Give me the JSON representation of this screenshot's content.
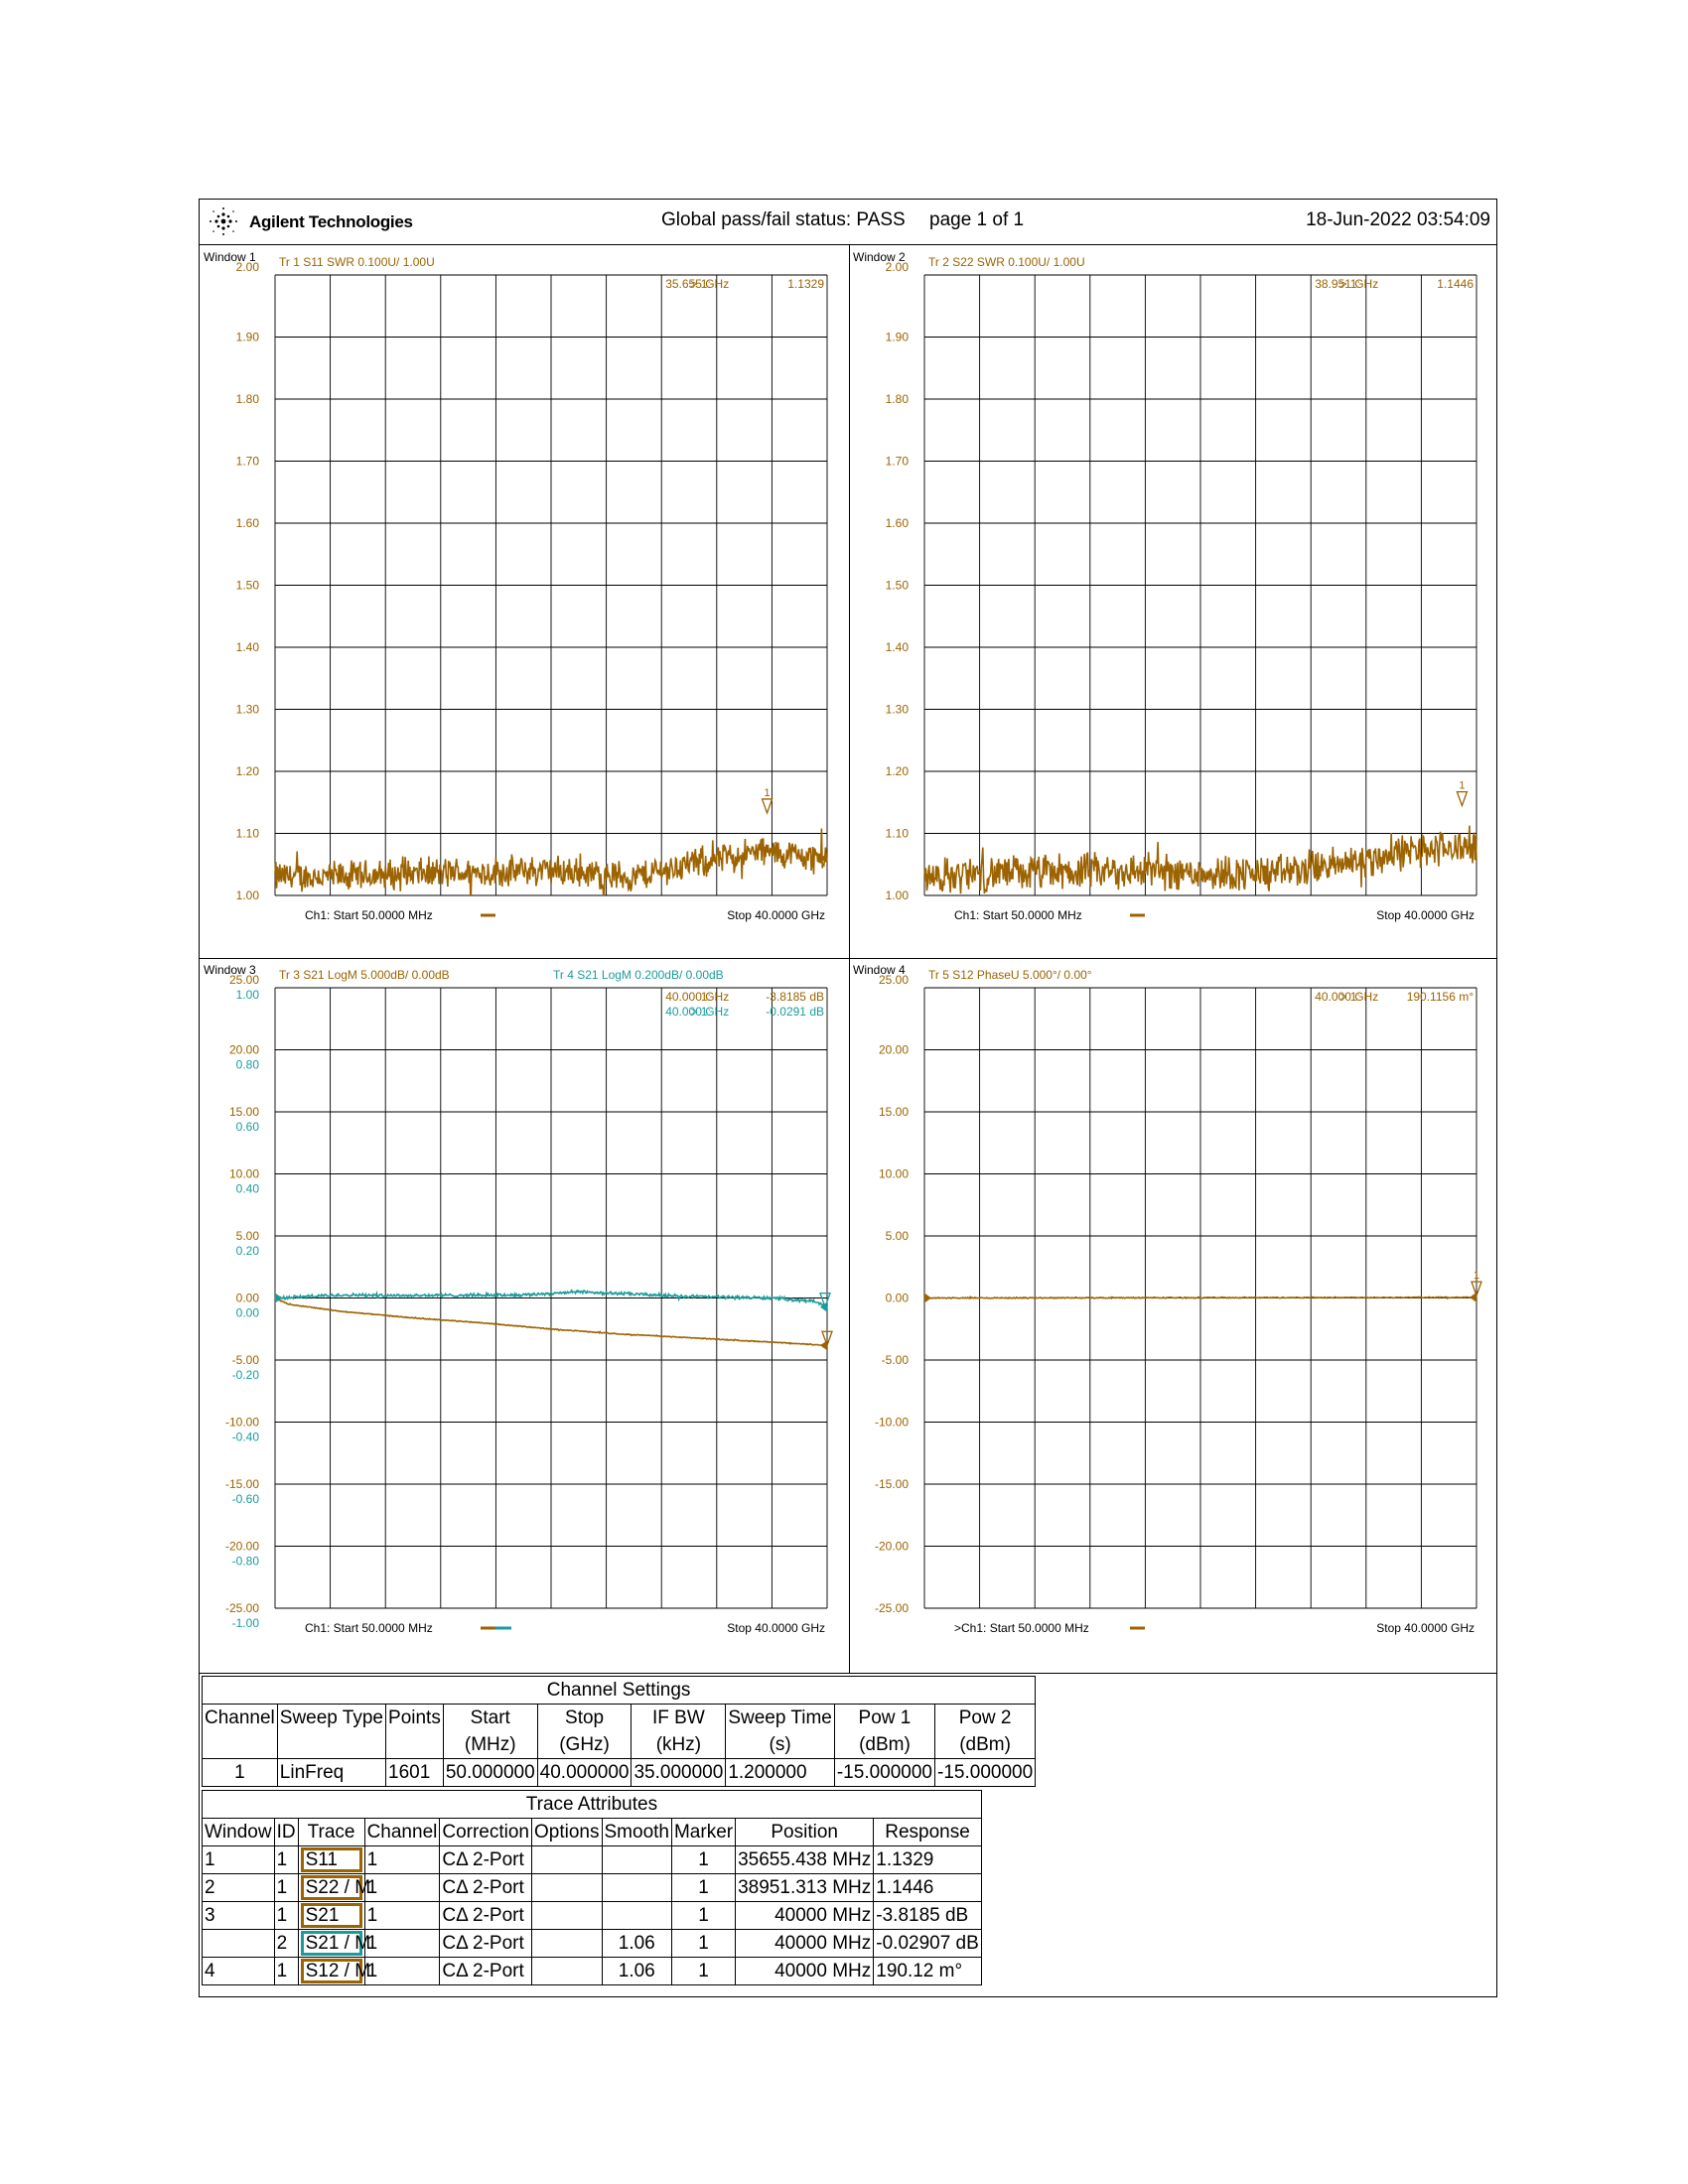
{
  "header": {
    "brand": "Agilent Technologies",
    "status": "Global pass/fail status: PASS",
    "page": "page  1 of  1",
    "datetime": "18-Jun-2022   03:54:09"
  },
  "colors": {
    "trace_brown": "#9c6300",
    "trace_teal": "#1a9c9c"
  },
  "chart_data": [
    {
      "type": "line",
      "window_label": "Window 1",
      "trace_label": "Tr  1   S11 SWR 0.100U/  1.00U",
      "marker": {
        "prefix": "> 1:",
        "x": "35.655 GHz",
        "value": "1.1329",
        "x_ghz": 35.655,
        "y": 1.1329,
        "id": "1"
      },
      "ylim": [
        1.0,
        2.0
      ],
      "yticks": [
        "2.00",
        "1.90",
        "1.80",
        "1.70",
        "1.60",
        "1.50",
        "1.40",
        "1.30",
        "1.20",
        "1.10",
        "1.00"
      ],
      "start_label": "Ch1: Start  50.0000 MHz",
      "stop_label": "Stop  40.0000 GHz",
      "xlim": [
        0.05,
        40.0
      ],
      "series": [
        {
          "color": "#9c6300",
          "mean": [
            [
              0.05,
              1.03
            ],
            [
              5,
              1.03
            ],
            [
              10,
              1.035
            ],
            [
              20,
              1.04
            ],
            [
              26,
              1.03
            ],
            [
              30,
              1.05
            ],
            [
              35,
              1.07
            ],
            [
              40,
              1.06
            ]
          ],
          "noise": 0.03
        }
      ]
    },
    {
      "type": "line",
      "window_label": "Window 2",
      "trace_label": "Tr  2   S22 SWR 0.100U/  1.00U",
      "marker": {
        "prefix": "> 1:",
        "x": "38.951 GHz",
        "value": "1.1446",
        "x_ghz": 38.951,
        "y": 1.1446,
        "id": "1"
      },
      "ylim": [
        1.0,
        2.0
      ],
      "yticks": [
        "2.00",
        "1.90",
        "1.80",
        "1.70",
        "1.60",
        "1.50",
        "1.40",
        "1.30",
        "1.20",
        "1.10",
        "1.00"
      ],
      "start_label": "Ch1: Start  50.0000 MHz",
      "stop_label": "Stop  40.0000 GHz",
      "xlim": [
        0.05,
        40.0
      ],
      "series": [
        {
          "color": "#9c6300",
          "mean": [
            [
              0.05,
              1.03
            ],
            [
              5,
              1.035
            ],
            [
              15,
              1.04
            ],
            [
              25,
              1.035
            ],
            [
              30,
              1.05
            ],
            [
              35,
              1.07
            ],
            [
              40,
              1.08
            ]
          ],
          "noise": 0.035
        }
      ]
    },
    {
      "type": "line",
      "window_label": "Window 3",
      "trace_label": "Tr  3   S21 LogM 5.000dB/  0.00dB",
      "trace_label2": "Tr  4   S21 LogM 0.200dB/  0.00dB",
      "marker": {
        "prefix": "1:",
        "x": "40.000 GHz",
        "value": "-3.8185 dB",
        "x_ghz": 40.0,
        "y": -3.8185,
        "id": ""
      },
      "marker2": {
        "prefix": "> 1:",
        "x": "40.000 GHz",
        "value": "-0.0291 dB",
        "x_ghz": 40.0,
        "y": -0.0291,
        "id": ""
      },
      "ylim": [
        -25,
        25
      ],
      "yticks": [
        "25.00",
        "20.00",
        "15.00",
        "10.00",
        "5.00",
        "0.00",
        "-5.00",
        "-10.00",
        "-15.00",
        "-20.00",
        "-25.00"
      ],
      "yticks2": [
        "1.00",
        "0.80",
        "0.60",
        "0.40",
        "0.20",
        "0.00",
        "-0.20",
        "-0.40",
        "-0.60",
        "-0.80",
        "-1.00"
      ],
      "start_label": "Ch1: Start  50.0000 MHz",
      "stop_label": "Stop  40.0000 GHz",
      "xlim": [
        0.05,
        40.0
      ],
      "series": [
        {
          "color": "#9c6300",
          "mean": [
            [
              0.05,
              0
            ],
            [
              1,
              -0.5
            ],
            [
              5,
              -1.1
            ],
            [
              10,
              -1.6
            ],
            [
              15,
              -2.0
            ],
            [
              20,
              -2.5
            ],
            [
              25,
              -2.9
            ],
            [
              30,
              -3.2
            ],
            [
              35,
              -3.5
            ],
            [
              40,
              -3.82
            ]
          ],
          "noise": 0.04
        },
        {
          "color": "#1a9c9c",
          "scale": 25,
          "mean": [
            [
              0.05,
              0
            ],
            [
              5,
              0.01
            ],
            [
              10,
              0.008
            ],
            [
              18,
              0.01
            ],
            [
              22,
              0.02
            ],
            [
              30,
              0.005
            ],
            [
              36,
              0
            ],
            [
              39,
              -0.01
            ],
            [
              40,
              -0.029
            ]
          ],
          "noise": 0.006
        }
      ]
    },
    {
      "type": "line",
      "window_label": "Window 4",
      "trace_label": "Tr  5   S12 PhaseU 5.000°/  0.00°",
      "marker": {
        "prefix": "> 1:",
        "x": "40.000 GHz",
        "value": "190.1156 m°",
        "x_ghz": 40.0,
        "y": 0.19,
        "id": "1"
      },
      "ylim": [
        -25,
        25
      ],
      "yticks": [
        "25.00",
        "20.00",
        "15.00",
        "10.00",
        "5.00",
        "0.00",
        "-5.00",
        "-10.00",
        "-15.00",
        "-20.00",
        "-25.00"
      ],
      "start_label": ">Ch1: Start  50.0000 MHz",
      "stop_label": "Stop  40.0000 GHz",
      "xlim": [
        0.05,
        40.0
      ],
      "series": [
        {
          "color": "#9c6300",
          "mean": [
            [
              0.05,
              0
            ],
            [
              40,
              0.05
            ]
          ],
          "noise": 0.05
        }
      ]
    }
  ],
  "channel_settings": {
    "title": "Channel Settings",
    "headers": [
      "Channel",
      "Sweep Type",
      "Points",
      "Start",
      "Stop",
      "IF BW",
      "Sweep Time",
      "Pow 1",
      "Pow 2"
    ],
    "units": [
      "",
      "",
      "",
      "(MHz)",
      "(GHz)",
      "(kHz)",
      "(s)",
      "(dBm)",
      "(dBm)"
    ],
    "rows": [
      [
        "1",
        "LinFreq",
        "1601",
        "50.000000",
        "40.000000",
        "35.000000",
        "1.200000",
        "-15.000000",
        "-15.000000"
      ]
    ]
  },
  "trace_attributes": {
    "title": "Trace Attributes",
    "headers": [
      "Window",
      "ID",
      "Trace",
      "Channel",
      "Correction",
      "Options",
      "Smooth",
      "Marker",
      "Position",
      "Response"
    ],
    "rows": [
      [
        "1",
        "1",
        "S11",
        "1",
        "CΔ 2-Port",
        "",
        "",
        "1",
        "35655.438 MHz",
        "1.1329"
      ],
      [
        "2",
        "1",
        "S22 / M",
        "1",
        "CΔ 2-Port",
        "",
        "",
        "1",
        "38951.313 MHz",
        "1.1446"
      ],
      [
        "3",
        "1",
        "S21",
        "1",
        "CΔ 2-Port",
        "",
        "",
        "1",
        "40000 MHz",
        "-3.8185 dB"
      ],
      [
        "",
        "2",
        "S21 / M",
        "1",
        "CΔ 2-Port",
        "",
        "1.06",
        "1",
        "40000 MHz",
        "-0.02907 dB"
      ],
      [
        "4",
        "1",
        "S12 / M",
        "1",
        "CΔ 2-Port",
        "",
        "1.06",
        "1",
        "40000 MHz",
        "190.12 m°"
      ]
    ],
    "trace_colors": [
      "#9c6300",
      "#9c6300",
      "#9c6300",
      "#1a9c9c",
      "#9c6300"
    ]
  }
}
